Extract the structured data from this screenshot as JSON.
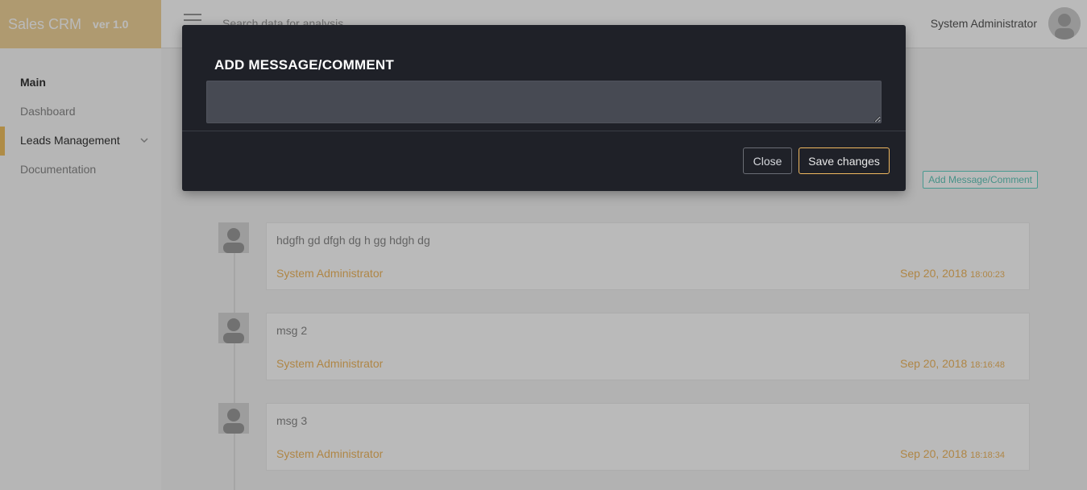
{
  "app": {
    "name": "Sales CRM",
    "version": "ver 1.0"
  },
  "topbar": {
    "search_placeholder": "Search data for analysis",
    "user_name": "System Administrator",
    "menu_icon": "hamburger-icon",
    "avatar_icon": "user-avatar"
  },
  "sidebar": {
    "items": [
      {
        "label": "Main"
      },
      {
        "label": "Dashboard"
      },
      {
        "label": "Leads Management",
        "active": true,
        "icon": "chevron-down-icon"
      },
      {
        "label": "Documentation"
      }
    ]
  },
  "content": {
    "add_message_label": "Add Message/Comment",
    "messages": [
      {
        "text": "hdgfh gd dfgh dg h gg hdgh dg",
        "author": "System Administrator",
        "date": "Sep 20, 2018",
        "time": "18:00:23"
      },
      {
        "text": "msg 2",
        "author": "System Administrator",
        "date": "Sep 20, 2018",
        "time": "18:16:48"
      },
      {
        "text": "msg 3",
        "author": "System Administrator",
        "date": "Sep 20, 2018",
        "time": "18:18:34"
      }
    ]
  },
  "modal": {
    "title": "ADD MESSAGE/COMMENT",
    "textarea_value": "",
    "close_label": "Close",
    "save_label": "Save changes"
  },
  "colors": {
    "brand": "#f0d49a",
    "accent": "#f0b860",
    "modal_bg": "#1f2128",
    "teal": "#63d3c6"
  }
}
